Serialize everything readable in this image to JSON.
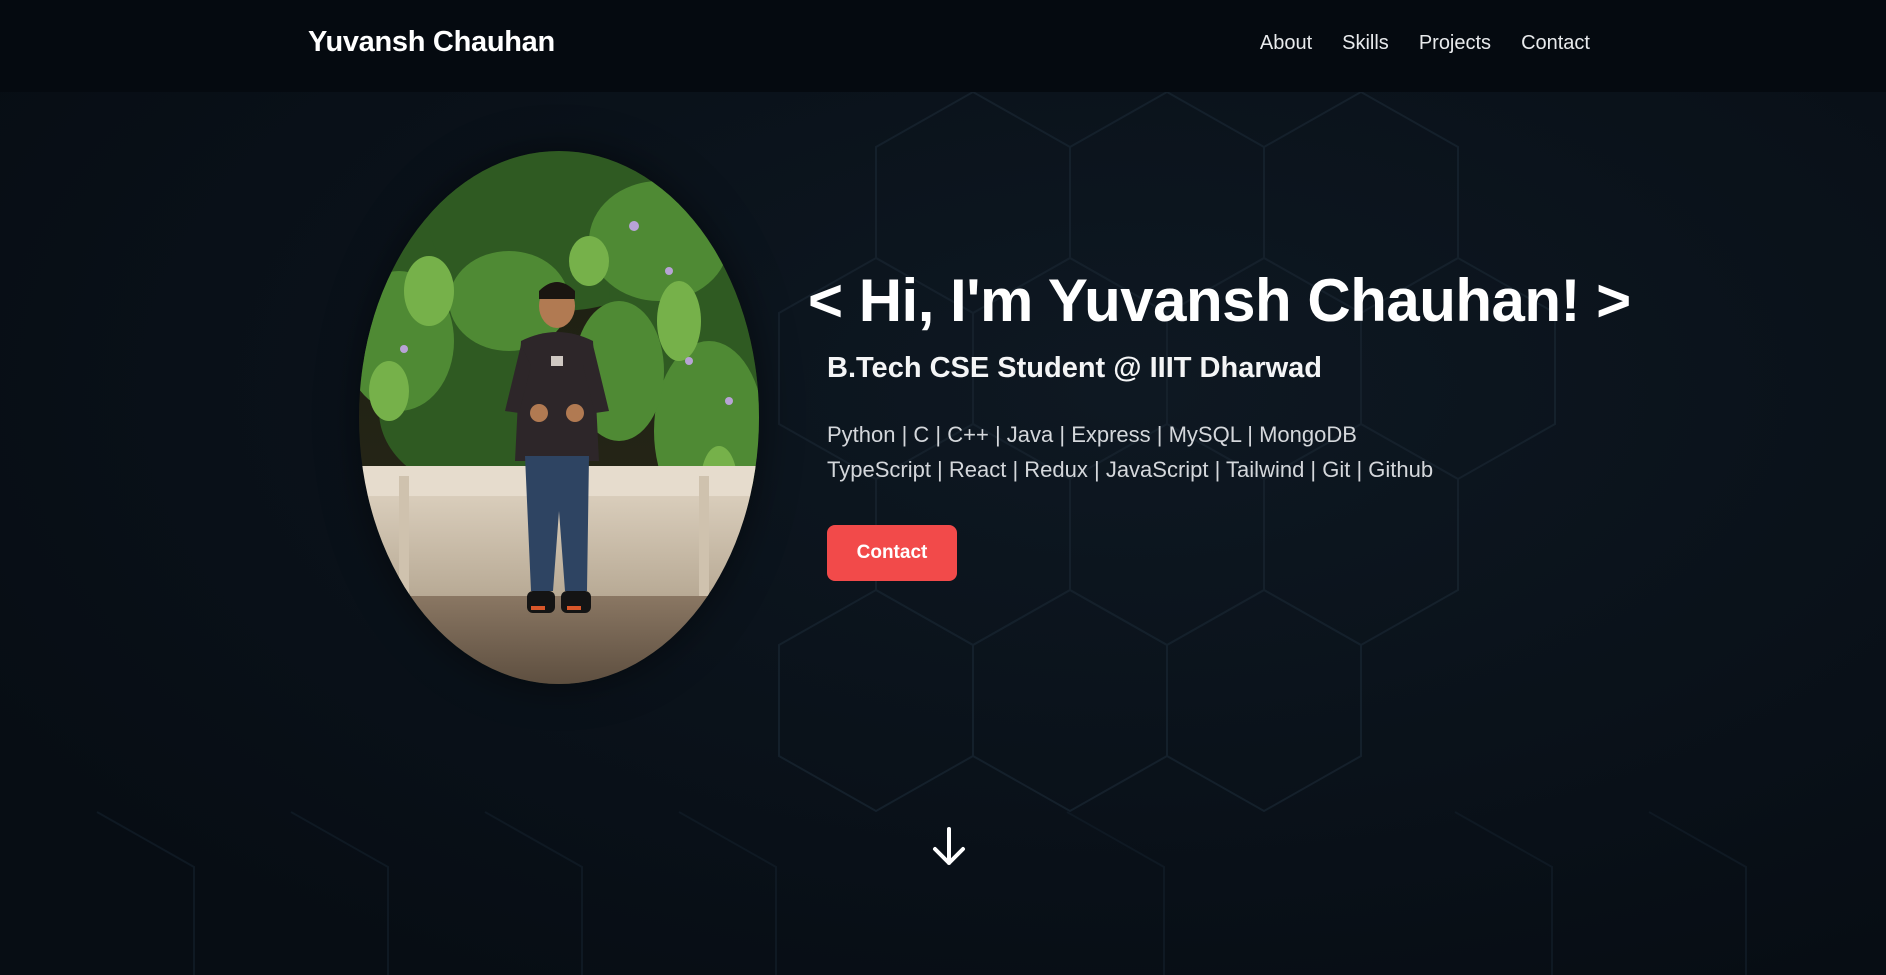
{
  "header": {
    "brand": "Yuvansh Chauhan",
    "nav": [
      {
        "label": "About"
      },
      {
        "label": "Skills"
      },
      {
        "label": "Projects"
      },
      {
        "label": "Contact"
      }
    ]
  },
  "hero": {
    "title": "< Hi, I'm Yuvansh Chauhan! >",
    "subtitle": "B.Tech CSE Student @ IIIT Dharwad",
    "skills": [
      "Python | C | C++ | Java | Express | MySQL | MongoDB",
      "TypeScript | React | Redux | JavaScript | Tailwind | Git | Github"
    ],
    "contact_button": "Contact",
    "scroll_icon": "arrow-down-icon",
    "photo_icon": "profile-photo"
  },
  "colors": {
    "background": "#0b131c",
    "navbar": "#050a10",
    "accent": "#f24a4a",
    "text": "#ffffff"
  }
}
